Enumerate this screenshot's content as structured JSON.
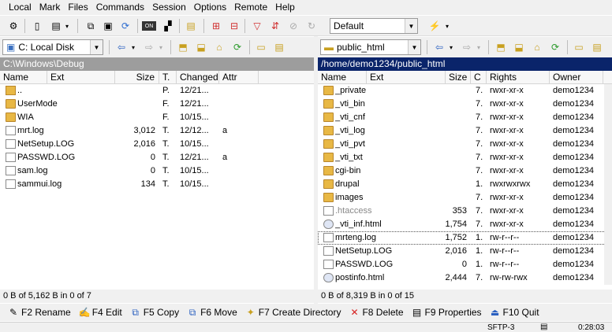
{
  "menu": [
    "Local",
    "Mark",
    "Files",
    "Commands",
    "Session",
    "Options",
    "Remote",
    "Help"
  ],
  "toolbar": {
    "profile": "Default"
  },
  "left": {
    "drive": "C: Local Disk",
    "path": "C:\\Windows\\Debug",
    "columns": {
      "name": "Name",
      "ext": "Ext",
      "size": "Size",
      "type": "T.",
      "changed": "Changed",
      "attr": "Attr"
    },
    "rows": [
      {
        "name": "..",
        "size": "",
        "type": "P.",
        "changed": "12/21...",
        "attr": "",
        "icon": "up"
      },
      {
        "name": "UserMode",
        "size": "",
        "type": "F.",
        "changed": "12/21...",
        "attr": "",
        "icon": "folder"
      },
      {
        "name": "WIA",
        "size": "",
        "type": "F.",
        "changed": "10/15...",
        "attr": "",
        "icon": "folder"
      },
      {
        "name": "mrt.log",
        "size": "3,012",
        "type": "T.",
        "changed": "12/12...",
        "attr": "a",
        "icon": "file"
      },
      {
        "name": "NetSetup.LOG",
        "size": "2,016",
        "type": "T.",
        "changed": "10/15...",
        "attr": "",
        "icon": "file"
      },
      {
        "name": "PASSWD.LOG",
        "size": "0",
        "type": "T.",
        "changed": "12/21...",
        "attr": "a",
        "icon": "file"
      },
      {
        "name": "sam.log",
        "size": "0",
        "type": "T.",
        "changed": "10/15...",
        "attr": "",
        "icon": "file"
      },
      {
        "name": "sammui.log",
        "size": "134",
        "type": "T.",
        "changed": "10/15...",
        "attr": "",
        "icon": "file"
      }
    ],
    "status": "0 B of 5,162 B in 0 of 7"
  },
  "right": {
    "folder": "public_html",
    "path": "/home/demo1234/public_html",
    "columns": {
      "name": "Name",
      "ext": "Ext",
      "size": "Size",
      "c": "C",
      "rights": "Rights",
      "owner": "Owner"
    },
    "rows": [
      {
        "name": "_private",
        "size": "",
        "c": "7.",
        "rights": "rwxr-xr-x",
        "owner": "demo1234",
        "icon": "folder"
      },
      {
        "name": "_vti_bin",
        "size": "",
        "c": "7.",
        "rights": "rwxr-xr-x",
        "owner": "demo1234",
        "icon": "folder"
      },
      {
        "name": "_vti_cnf",
        "size": "",
        "c": "7.",
        "rights": "rwxr-xr-x",
        "owner": "demo1234",
        "icon": "folder"
      },
      {
        "name": "_vti_log",
        "size": "",
        "c": "7.",
        "rights": "rwxr-xr-x",
        "owner": "demo1234",
        "icon": "folder"
      },
      {
        "name": "_vti_pvt",
        "size": "",
        "c": "7.",
        "rights": "rwxr-xr-x",
        "owner": "demo1234",
        "icon": "folder"
      },
      {
        "name": "_vti_txt",
        "size": "",
        "c": "7.",
        "rights": "rwxr-xr-x",
        "owner": "demo1234",
        "icon": "folder"
      },
      {
        "name": "cgi-bin",
        "size": "",
        "c": "7.",
        "rights": "rwxr-xr-x",
        "owner": "demo1234",
        "icon": "folder"
      },
      {
        "name": "drupal",
        "size": "",
        "c": "1.",
        "rights": "rwxrwxrwx",
        "owner": "demo1234",
        "icon": "folder"
      },
      {
        "name": "images",
        "size": "",
        "c": "7.",
        "rights": "rwxr-xr-x",
        "owner": "demo1234",
        "icon": "folder"
      },
      {
        "name": ".htaccess",
        "size": "353",
        "c": "7.",
        "rights": "rwxr-xr-x",
        "owner": "demo1234",
        "icon": "file"
      },
      {
        "name": "_vti_inf.html",
        "size": "1,754",
        "c": "7.",
        "rights": "rwxr-xr-x",
        "owner": "demo1234",
        "icon": "html"
      },
      {
        "name": "mrteng.log",
        "size": "1,752",
        "c": "1.",
        "rights": "rw-r--r--",
        "owner": "demo1234",
        "icon": "file"
      },
      {
        "name": "NetSetup.LOG",
        "size": "2,016",
        "c": "1.",
        "rights": "rw-r--r--",
        "owner": "demo1234",
        "icon": "file"
      },
      {
        "name": "PASSWD.LOG",
        "size": "0",
        "c": "1.",
        "rights": "rw-r--r--",
        "owner": "demo1234",
        "icon": "file"
      },
      {
        "name": "postinfo.html",
        "size": "2,444",
        "c": "7.",
        "rights": "rw-rw-rwx",
        "owner": "demo1234",
        "icon": "html"
      }
    ],
    "status": "0 B of 8,319 B in 0 of 15"
  },
  "fkeys": [
    {
      "label": "F2 Rename",
      "icon": "rename-icon"
    },
    {
      "label": "F4 Edit",
      "icon": "edit-icon"
    },
    {
      "label": "F5 Copy",
      "icon": "copy-icon"
    },
    {
      "label": "F6 Move",
      "icon": "move-icon"
    },
    {
      "label": "F7 Create Directory",
      "icon": "create-directory-icon"
    },
    {
      "label": "F8 Delete",
      "icon": "delete-icon"
    },
    {
      "label": "F9 Properties",
      "icon": "properties-icon"
    },
    {
      "label": "F10 Quit",
      "icon": "quit-icon"
    }
  ],
  "bottom": {
    "protocol": "SFTP-3",
    "time": "0:28:03"
  },
  "colors": {
    "left_path_bg": "#9d9d9d",
    "right_path_bg": "#0a246a",
    "folder": "#e8b845",
    "delete": "#d62020"
  }
}
